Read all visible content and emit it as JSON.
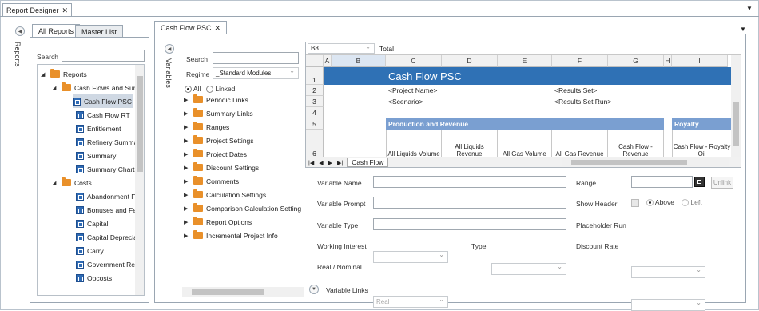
{
  "window": {
    "tab_title": "Report Designer"
  },
  "reports_rail": {
    "label": "Reports"
  },
  "left_panel": {
    "tabs": [
      {
        "label": "All Reports"
      },
      {
        "label": "Master List"
      }
    ],
    "search_label": "Search",
    "tree": [
      {
        "label": "Reports"
      },
      {
        "label": "Cash Flows and Sum"
      },
      {
        "label": "Cash Flow PSC"
      },
      {
        "label": "Cash Flow RT"
      },
      {
        "label": "Entitlement"
      },
      {
        "label": "Refinery Summa"
      },
      {
        "label": "Summary"
      },
      {
        "label": "Summary Charts"
      },
      {
        "label": "Costs"
      },
      {
        "label": "Abandonment F"
      },
      {
        "label": "Bonuses and Fe"
      },
      {
        "label": "Capital"
      },
      {
        "label": "Capital Deprecia"
      },
      {
        "label": "Carry"
      },
      {
        "label": "Government Re"
      },
      {
        "label": "Opcosts"
      }
    ]
  },
  "doc_tab": {
    "label": "Cash Flow PSC"
  },
  "variables_rail": {
    "label": "Variables"
  },
  "variables_panel": {
    "search_label": "Search",
    "regime_label": "Regime",
    "regime_value": "_Standard Modules",
    "filter_all": "All",
    "filter_linked": "Linked",
    "groups": [
      {
        "label": "Periodic Links"
      },
      {
        "label": "Summary Links"
      },
      {
        "label": "Ranges"
      },
      {
        "label": "Project Settings"
      },
      {
        "label": "Project Dates"
      },
      {
        "label": "Discount Settings"
      },
      {
        "label": "Comments"
      },
      {
        "label": "Calculation Settings"
      },
      {
        "label": "Comparison Calculation Setting"
      },
      {
        "label": "Report Options"
      },
      {
        "label": "Incremental Project Info"
      }
    ]
  },
  "grid": {
    "cell_ref": "B8",
    "formula": "Total",
    "columns": [
      "A",
      "B",
      "C",
      "D",
      "E",
      "F",
      "G",
      "H",
      "I"
    ],
    "rows": [
      "1",
      "2",
      "3",
      "4",
      "5",
      "6"
    ],
    "title": "Cash Flow PSC",
    "project_name": "<Project Name>",
    "scenario": "<Scenario>",
    "results_set": "<Results Set>",
    "results_set_run": "<Results Set Run>",
    "section_production": "Production and Revenue",
    "section_royalty": "Royalty",
    "col_headers": [
      "All Liquids Volume",
      "All Liquids Revenue",
      "All Gas Volume",
      "All Gas Revenue",
      "Cash Flow - Revenue",
      "Cash Flow - Royalty Oil"
    ],
    "sheet_tab": "Cash Flow"
  },
  "props": {
    "variable_name": "Variable Name",
    "variable_prompt": "Variable Prompt",
    "variable_type": "Variable Type",
    "working_interest": "Working Interest",
    "type": "Type",
    "real_nominal": "Real / Nominal",
    "real_nominal_value": "Real",
    "range": "Range",
    "unlink": "Unlink",
    "show_header": "Show Header",
    "above": "Above",
    "left": "Left",
    "placeholder_run": "Placeholder Run",
    "discount_rate": "Discount Rate",
    "variable_links": "Variable Links"
  },
  "colors": {
    "accent": "#2f71b5",
    "section": "#7a9fd1",
    "folder": "#e9902a"
  }
}
